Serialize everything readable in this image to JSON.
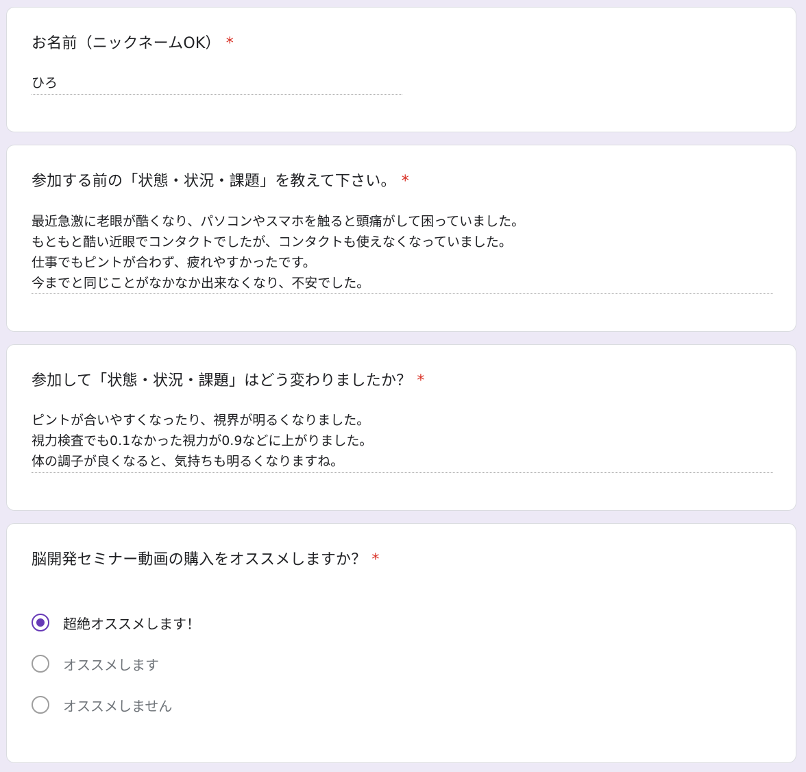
{
  "required_mark": "*",
  "questions": [
    {
      "title": "お名前（ニックネームOK）",
      "answer": "ひろ"
    },
    {
      "title": "参加する前の「状態・状況・課題」を教えて下さい。",
      "answer": "最近急激に老眼が酷くなり、パソコンやスマホを触ると頭痛がして困っていました。\nもともと酷い近眼でコンタクトでしたが、コンタクトも使えなくなっていました。\n仕事でもピントが合わず、疲れやすかったです。\n今までと同じことがなかなか出来なくなり、不安でした。"
    },
    {
      "title": "参加して「状態・状況・課題」はどう変わりましたか？",
      "answer": "ピントが合いやすくなったり、視界が明るくなりました。\n視力検査でも0.1なかった視力が0.9などに上がりました。\n体の調子が良くなると、気持ちも明るくなりますね。"
    },
    {
      "title": "脳開発セミナー動画の購入をオススメしますか？",
      "options": [
        {
          "label": "超絶オススメします！",
          "selected": true
        },
        {
          "label": "オススメします",
          "selected": false
        },
        {
          "label": "オススメしません",
          "selected": false
        }
      ]
    }
  ],
  "colors": {
    "accent": "#673ab7",
    "required": "#d93025",
    "background": "#ede9f6"
  }
}
